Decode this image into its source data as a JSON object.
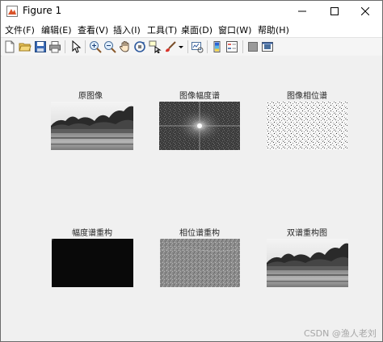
{
  "window": {
    "title": "Figure 1"
  },
  "menu": [
    "文件(F)",
    "编辑(E)",
    "查看(V)",
    "插入(I)",
    "工具(T)",
    "桌面(D)",
    "窗口(W)",
    "帮助(H)"
  ],
  "toolbar": [
    "new-figure-icon",
    "open-folder-icon",
    "save-icon",
    "print-icon",
    "pointer-icon",
    "zoom-in-icon",
    "zoom-out-icon",
    "pan-hand-icon",
    "rotate-3d-icon",
    "data-cursor-icon",
    "brush-icon",
    "dropdown-arrow-icon",
    "link-plot-icon",
    "colorbar-icon",
    "legend-icon",
    "hide-plot-tools-icon",
    "show-plot-tools-icon"
  ],
  "plots": [
    {
      "title": "原图像",
      "kind": "landscape"
    },
    {
      "title": "图像幅度谱",
      "kind": "magnitude-spectrum"
    },
    {
      "title": "图像相位谱",
      "kind": "phase-spectrum"
    },
    {
      "title": "幅度谱重构",
      "kind": "dark-reconstruction"
    },
    {
      "title": "相位谱重构",
      "kind": "noise-reconstruction"
    },
    {
      "title": "双谱重构图",
      "kind": "landscape"
    }
  ],
  "watermark": "CSDN @渔人老刘"
}
